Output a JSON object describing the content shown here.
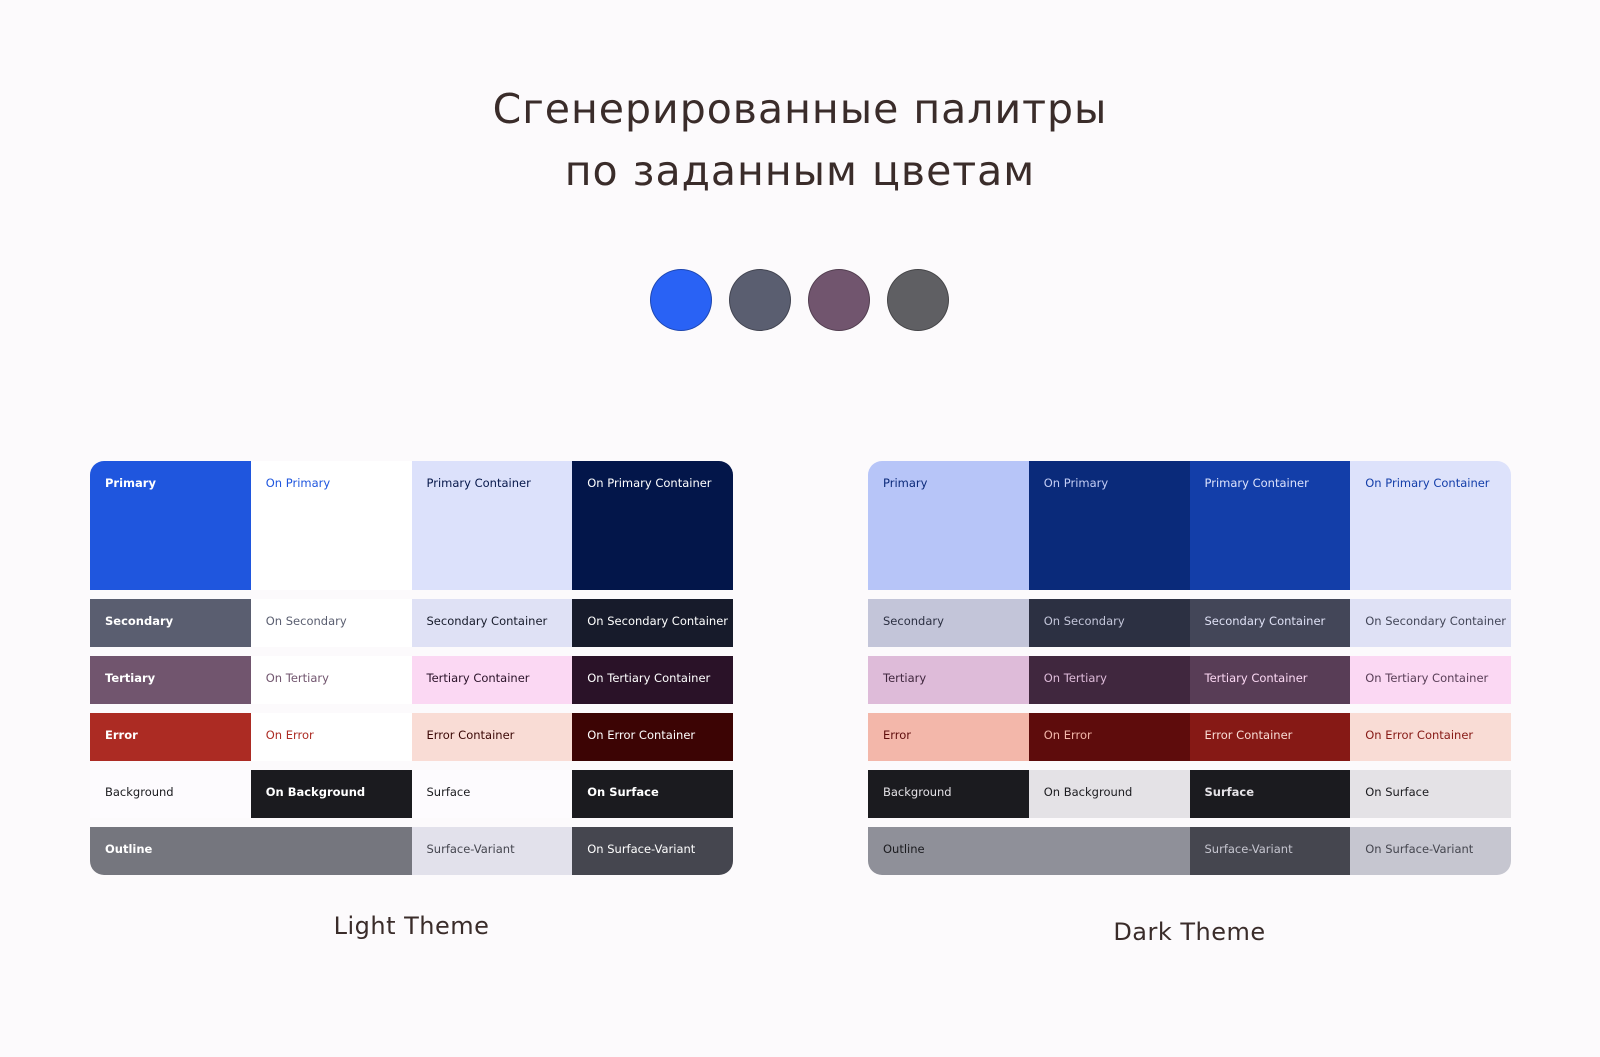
{
  "title": {
    "line1": "Сгенерированные палитры",
    "line2": "по заданным цветам"
  },
  "seed_colors": [
    "#2962f5",
    "#5a5e70",
    "#71556e",
    "#5f5f63"
  ],
  "light": {
    "caption": "Light Theme",
    "cells": [
      {
        "label": "Primary",
        "bg": "#1f56de",
        "fg": "#ffffff",
        "bold": true
      },
      {
        "label": "On Primary",
        "bg": "#ffffff",
        "fg": "#1f56de",
        "bold": false
      },
      {
        "label": "Primary Container",
        "bg": "#dce1fb",
        "fg": "#06174a",
        "bold": false
      },
      {
        "label": "On Primary Container",
        "bg": "#03164a",
        "fg": "#ffffff",
        "bold": false
      },
      {
        "label": "Secondary",
        "bg": "#5a5e70",
        "fg": "#ffffff",
        "bold": true
      },
      {
        "label": "On Secondary",
        "bg": "#ffffff",
        "fg": "#5a5e70",
        "bold": false
      },
      {
        "label": "Secondary Container",
        "bg": "#dfe1f5",
        "fg": "#171b2b",
        "bold": false
      },
      {
        "label": "On Secondary Container",
        "bg": "#171b2b",
        "fg": "#ffffff",
        "bold": false
      },
      {
        "label": "Tertiary",
        "bg": "#71556e",
        "fg": "#ffffff",
        "bold": true
      },
      {
        "label": "On Tertiary",
        "bg": "#ffffff",
        "fg": "#71556e",
        "bold": false
      },
      {
        "label": "Tertiary Container",
        "bg": "#fbd8f3",
        "fg": "#2a1228",
        "bold": false
      },
      {
        "label": "On Tertiary Container",
        "bg": "#2a1228",
        "fg": "#ffffff",
        "bold": false
      },
      {
        "label": "Error",
        "bg": "#ac2b23",
        "fg": "#ffffff",
        "bold": true
      },
      {
        "label": "On Error",
        "bg": "#ffffff",
        "fg": "#ac2b23",
        "bold": false
      },
      {
        "label": "Error Container",
        "bg": "#f9dcd5",
        "fg": "#3b0806",
        "bold": false
      },
      {
        "label": "On Error Container",
        "bg": "#3c0404",
        "fg": "#ffffff",
        "bold": false
      },
      {
        "label": "Background",
        "bg": "#fdfbfe",
        "fg": "#1b1b1f",
        "bold": false
      },
      {
        "label": "On Background",
        "bg": "#1b1b1f",
        "fg": "#ffffff",
        "bold": true
      },
      {
        "label": "Surface",
        "bg": "#fdfbfe",
        "fg": "#1b1b1f",
        "bold": false
      },
      {
        "label": "On Surface",
        "bg": "#1b1b1f",
        "fg": "#ffffff",
        "bold": true
      },
      {
        "label": "Outline",
        "bg": "#75767e",
        "fg": "#ffffff",
        "bold": true,
        "span": 2
      },
      {
        "label": "Surface-Variant",
        "bg": "#e2e1eb",
        "fg": "#45464f",
        "bold": false
      },
      {
        "label": "On Surface-Variant",
        "bg": "#45464f",
        "fg": "#ffffff",
        "bold": false
      }
    ]
  },
  "dark": {
    "caption": "Dark Theme",
    "cells": [
      {
        "label": "Primary",
        "bg": "#b7c5f8",
        "fg": "#0b2a7a",
        "bold": false
      },
      {
        "label": "On Primary",
        "bg": "#0a2a7a",
        "fg": "#c3cdf5",
        "bold": false
      },
      {
        "label": "Primary Container",
        "bg": "#133ea9",
        "fg": "#dde3fc",
        "bold": false
      },
      {
        "label": "On Primary Container",
        "bg": "#dde2fb",
        "fg": "#133ea9",
        "bold": false
      },
      {
        "label": "Secondary",
        "bg": "#c3c5d9",
        "fg": "#2c3042",
        "bold": false
      },
      {
        "label": "On Secondary",
        "bg": "#2c3042",
        "fg": "#c3c5d9",
        "bold": false
      },
      {
        "label": "Secondary Container",
        "bg": "#434658",
        "fg": "#dfe1f5",
        "bold": false
      },
      {
        "label": "On Secondary Container",
        "bg": "#dfe1f5",
        "fg": "#434658",
        "bold": false
      },
      {
        "label": "Tertiary",
        "bg": "#debbd9",
        "fg": "#40273e",
        "bold": false
      },
      {
        "label": "On Tertiary",
        "bg": "#40273e",
        "fg": "#debbd9",
        "bold": false
      },
      {
        "label": "Tertiary Container",
        "bg": "#583d56",
        "fg": "#fbd8f3",
        "bold": false
      },
      {
        "label": "On Tertiary Container",
        "bg": "#fbd8f3",
        "fg": "#583d56",
        "bold": false
      },
      {
        "label": "Error",
        "bg": "#f3b7aa",
        "fg": "#5f0d0d",
        "bold": false
      },
      {
        "label": "On Error",
        "bg": "#5e0c0c",
        "fg": "#f3b7aa",
        "bold": false
      },
      {
        "label": "Error Container",
        "bg": "#861915",
        "fg": "#f9dcd5",
        "bold": false
      },
      {
        "label": "On Error Container",
        "bg": "#f9dcd5",
        "fg": "#861915",
        "bold": false
      },
      {
        "label": "Background",
        "bg": "#1b1b1f",
        "fg": "#e4e2e6",
        "bold": false
      },
      {
        "label": "On Background",
        "bg": "#e4e2e6",
        "fg": "#1b1b1f",
        "bold": false
      },
      {
        "label": "Surface",
        "bg": "#1b1b1f",
        "fg": "#e4e2e6",
        "bold": true
      },
      {
        "label": "On Surface",
        "bg": "#e4e2e6",
        "fg": "#1b1b1f",
        "bold": false
      },
      {
        "label": "Outline",
        "bg": "#8f9099",
        "fg": "#1b1b1f",
        "bold": false,
        "span": 2
      },
      {
        "label": "Surface-Variant",
        "bg": "#45464f",
        "fg": "#c6c6d0",
        "bold": false
      },
      {
        "label": "On Surface-Variant",
        "bg": "#c6c6d0",
        "fg": "#45464f",
        "bold": false
      }
    ]
  }
}
